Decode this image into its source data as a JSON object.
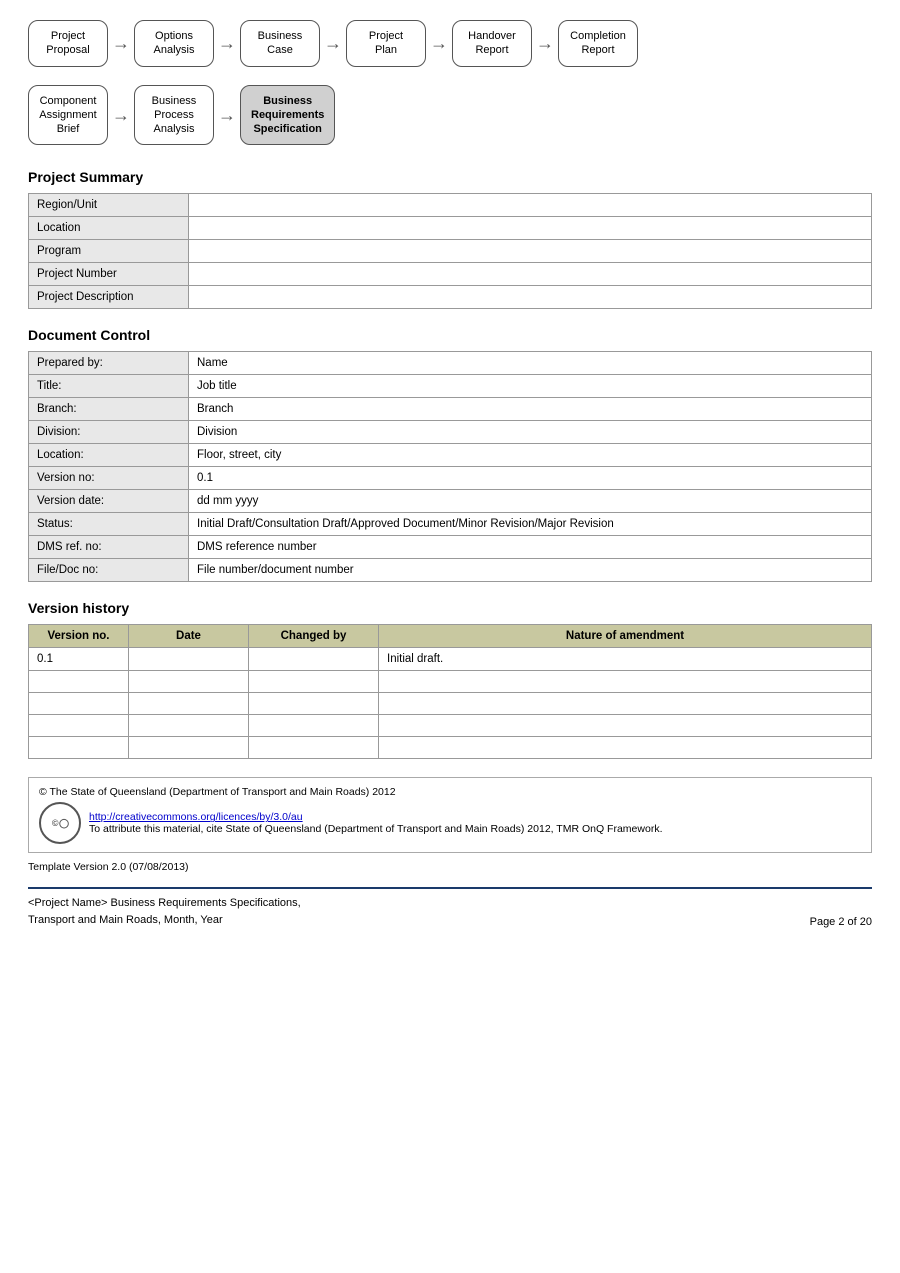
{
  "flowTop": {
    "nodes": [
      {
        "id": "project-proposal",
        "label": "Project\nProposal",
        "active": false
      },
      {
        "id": "options-analysis",
        "label": "Options\nAnalysis",
        "active": false
      },
      {
        "id": "business-case",
        "label": "Business\nCase",
        "active": false
      },
      {
        "id": "project-plan",
        "label": "Project\nPlan",
        "active": false
      },
      {
        "id": "handover-report",
        "label": "Handover\nReport",
        "active": false
      },
      {
        "id": "completion-report",
        "label": "Completion\nReport",
        "active": false
      }
    ]
  },
  "flowBottom": {
    "nodes": [
      {
        "id": "component-assignment-brief",
        "label": "Component\nAssignment\nBrief",
        "active": false
      },
      {
        "id": "business-process-analysis",
        "label": "Business\nProcess\nAnalysis",
        "active": false
      },
      {
        "id": "business-requirements-specification",
        "label": "Business\nRequirements\nSpecification",
        "active": true
      }
    ]
  },
  "projectSummary": {
    "heading": "Project Summary",
    "rows": [
      {
        "label": "Region/Unit",
        "value": ""
      },
      {
        "label": "Location",
        "value": ""
      },
      {
        "label": "Program",
        "value": ""
      },
      {
        "label": "Project Number",
        "value": ""
      },
      {
        "label": "Project Description",
        "value": ""
      }
    ]
  },
  "documentControl": {
    "heading": "Document Control",
    "rows": [
      {
        "label": "Prepared by:",
        "value": "Name"
      },
      {
        "label": "Title:",
        "value": "Job title"
      },
      {
        "label": "Branch:",
        "value": "Branch"
      },
      {
        "label": "Division:",
        "value": "Division"
      },
      {
        "label": "Location:",
        "value": "Floor, street, city"
      },
      {
        "label": "Version no:",
        "value": "0.1"
      },
      {
        "label": "Version date:",
        "value": "dd mm yyyy"
      },
      {
        "label": "Status:",
        "value": "Initial Draft/Consultation Draft/Approved Document/Minor Revision/Major Revision"
      },
      {
        "label": "DMS ref. no:",
        "value": "DMS reference number"
      },
      {
        "label": "File/Doc no:",
        "value": "File number/document number"
      }
    ]
  },
  "versionHistory": {
    "heading": "Version history",
    "columns": [
      "Version no.",
      "Date",
      "Changed by",
      "Nature of amendment"
    ],
    "rows": [
      {
        "version": "0.1",
        "date": "",
        "changedBy": "",
        "nature": "Initial draft."
      },
      {
        "version": "",
        "date": "",
        "changedBy": "",
        "nature": ""
      },
      {
        "version": "",
        "date": "",
        "changedBy": "",
        "nature": ""
      },
      {
        "version": "",
        "date": "",
        "changedBy": "",
        "nature": ""
      },
      {
        "version": "",
        "date": "",
        "changedBy": "",
        "nature": ""
      }
    ]
  },
  "footer": {
    "copyrightLine": "© The State of Queensland (Department of Transport and Main Roads) 2012",
    "ccLink": "http://creativecommons.org/licences/by/3.0/au",
    "attributionLine": "To attribute this material, cite State of Queensland (Department of Transport and Main Roads) 2012, TMR OnQ Framework.",
    "templateVersion": "Template Version 2.0 (07/08/2013)"
  },
  "pageFooter": {
    "leftLine1": "<Project Name> Business Requirements Specifications,",
    "leftLine2": "Transport and Main Roads, Month, Year",
    "rightText": "Page 2 of 20"
  }
}
